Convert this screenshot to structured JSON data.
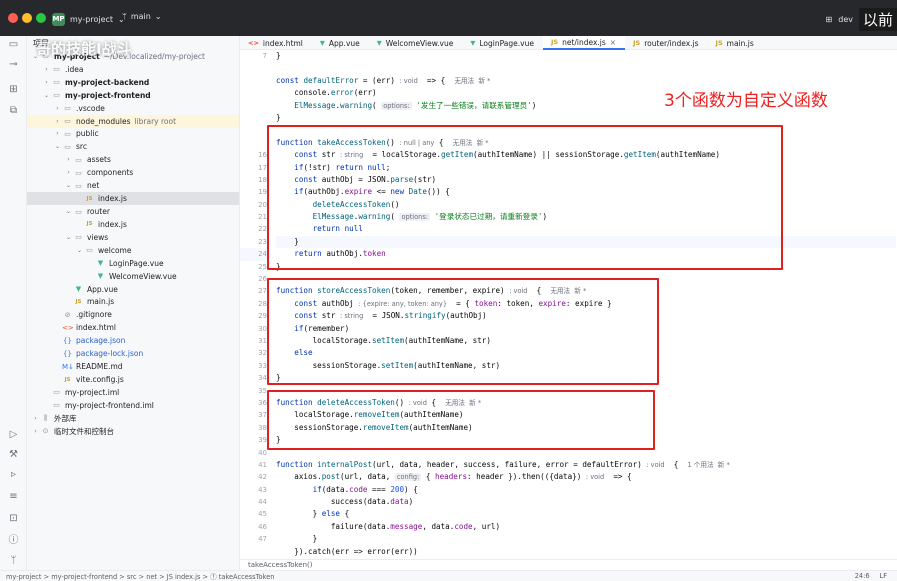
{
  "window": {
    "project_badge": "MP",
    "project_name": "my-project",
    "branch": "main",
    "right_text": "dev",
    "overlay_text": "以前"
  },
  "tabs": [
    {
      "label": "index.html",
      "icon": "<>",
      "color": "#e44d26",
      "active": false
    },
    {
      "label": "App.vue",
      "icon": "▼",
      "color": "#3fb883",
      "active": false
    },
    {
      "label": "WelcomeView.vue",
      "icon": "▼",
      "color": "#3fb883",
      "active": false
    },
    {
      "label": "LoginPage.vue",
      "icon": "▼",
      "color": "#3fb883",
      "active": false
    },
    {
      "label": "net/index.js",
      "icon": "JS",
      "color": "#c9a227",
      "active": true
    },
    {
      "label": "router/index.js",
      "icon": "JS",
      "color": "#c9a227",
      "active": false
    },
    {
      "label": "main.js",
      "icon": "JS",
      "color": "#c9a227",
      "active": false
    }
  ],
  "project_panel": {
    "title": "项目",
    "watermark": "哥的技能Ⅰ战斗"
  },
  "tree": [
    {
      "d": 0,
      "a": "v",
      "ic": "📁",
      "t": "my-project",
      "b": true,
      "m": "~/Dev.localized/my-project"
    },
    {
      "d": 1,
      "a": ">",
      "ic": "📁",
      "t": ".idea"
    },
    {
      "d": 1,
      "a": ">",
      "ic": "📁",
      "t": "my-project-backend",
      "b": true
    },
    {
      "d": 1,
      "a": "v",
      "ic": "📁",
      "t": "my-project-frontend",
      "b": true
    },
    {
      "d": 2,
      "a": ">",
      "ic": "📁",
      "t": ".vscode"
    },
    {
      "d": 2,
      "a": ">",
      "ic": "📁",
      "t": "node_modules",
      "m": "library root",
      "h": true
    },
    {
      "d": 2,
      "a": ">",
      "ic": "📁",
      "t": "public"
    },
    {
      "d": 2,
      "a": "v",
      "ic": "📁",
      "t": "src"
    },
    {
      "d": 3,
      "a": ">",
      "ic": "📁",
      "t": "assets"
    },
    {
      "d": 3,
      "a": ">",
      "ic": "📁",
      "t": "components"
    },
    {
      "d": 3,
      "a": "v",
      "ic": "📁",
      "t": "net"
    },
    {
      "d": 4,
      "a": "",
      "ic": "JS",
      "t": "index.js",
      "s": true
    },
    {
      "d": 3,
      "a": "v",
      "ic": "📁",
      "t": "router"
    },
    {
      "d": 4,
      "a": "",
      "ic": "JS",
      "t": "index.js"
    },
    {
      "d": 3,
      "a": "v",
      "ic": "📁",
      "t": "views"
    },
    {
      "d": 4,
      "a": "v",
      "ic": "📁",
      "t": "welcome"
    },
    {
      "d": 5,
      "a": "",
      "ic": "▼",
      "t": "LoginPage.vue"
    },
    {
      "d": 5,
      "a": "",
      "ic": "▼",
      "t": "WelcomeView.vue"
    },
    {
      "d": 3,
      "a": "",
      "ic": "▼",
      "t": "App.vue"
    },
    {
      "d": 3,
      "a": "",
      "ic": "JS",
      "t": "main.js"
    },
    {
      "d": 2,
      "a": "",
      "ic": "⊘",
      "t": ".gitignore"
    },
    {
      "d": 2,
      "a": "",
      "ic": "<>",
      "t": "index.html"
    },
    {
      "d": 2,
      "a": "",
      "ic": "{}",
      "t": "package.json",
      "blue": true
    },
    {
      "d": 2,
      "a": "",
      "ic": "{}",
      "t": "package-lock.json",
      "blue": true
    },
    {
      "d": 2,
      "a": "",
      "ic": "M↓",
      "t": "README.md"
    },
    {
      "d": 2,
      "a": "",
      "ic": "JS",
      "t": "vite.config.js"
    },
    {
      "d": 1,
      "a": "",
      "ic": "▭",
      "t": "my-project.iml"
    },
    {
      "d": 1,
      "a": "",
      "ic": "▭",
      "t": "my-project-frontend.iml"
    },
    {
      "d": 0,
      "a": ">",
      "ic": "⫼",
      "t": "外部库"
    },
    {
      "d": 0,
      "a": ">",
      "ic": "⊙",
      "t": "临时文件和控制台"
    }
  ],
  "gutter": [
    "7",
    "",
    "",
    "",
    "",
    "",
    "",
    "",
    "16",
    "17",
    "18",
    "19",
    "20",
    "21",
    "22",
    "23",
    "24",
    "25",
    "26",
    "27",
    "28",
    "29",
    "30",
    "31",
    "32",
    "33",
    "34",
    "35",
    "36",
    "37",
    "38",
    "39",
    "40",
    "41",
    "42",
    "43",
    "44",
    "45",
    "46",
    "47",
    ""
  ],
  "code": [
    [
      [
        "p",
        "}"
      ]
    ],
    [
      [
        "p",
        ""
      ]
    ],
    [
      [
        "kw",
        "const "
      ],
      [
        "fn",
        "defaultError"
      ],
      [
        "p",
        " = ("
      ],
      [
        "p",
        "err"
      ],
      [
        "p",
        ") "
      ],
      [
        "hint",
        ": void"
      ],
      [
        "p",
        "  => {  "
      ],
      [
        "hint",
        "无用法  新 *"
      ]
    ],
    [
      [
        "p",
        "    console."
      ],
      [
        "fn",
        "error"
      ],
      [
        "p",
        "(err)"
      ]
    ],
    [
      [
        "p",
        "    "
      ],
      [
        "fn",
        "ElMessage"
      ],
      [
        "p",
        "."
      ],
      [
        "fn",
        "warning"
      ],
      [
        "p",
        "( "
      ],
      [
        "hintbox",
        "options:"
      ],
      [
        "str",
        " '发生了一些错误，请联系管理员'"
      ],
      [
        "p",
        ")"
      ]
    ],
    [
      [
        "p",
        "}"
      ]
    ],
    [
      [
        "p",
        ""
      ]
    ],
    [
      [
        "kw",
        "function "
      ],
      [
        "fn",
        "takeAccessToken"
      ],
      [
        "p",
        "() "
      ],
      [
        "hint",
        ": null | any"
      ],
      [
        "p",
        " {  "
      ],
      [
        "hint",
        "无用法  新 *"
      ]
    ],
    [
      [
        "p",
        "    "
      ],
      [
        "kw",
        "const "
      ],
      [
        "p",
        "str "
      ],
      [
        "hint",
        ": string"
      ],
      [
        "p",
        "  = localStorage."
      ],
      [
        "fn",
        "getItem"
      ],
      [
        "p",
        "(authItemName) || sessionStorage."
      ],
      [
        "fn",
        "getItem"
      ],
      [
        "p",
        "(authItemName)"
      ]
    ],
    [
      [
        "p",
        "    "
      ],
      [
        "kw",
        "if"
      ],
      [
        "p",
        "(!str) "
      ],
      [
        "kw",
        "return null"
      ],
      [
        "p",
        ";"
      ]
    ],
    [
      [
        "p",
        "    "
      ],
      [
        "kw",
        "const "
      ],
      [
        "p",
        "authObj = JSON."
      ],
      [
        "fn",
        "parse"
      ],
      [
        "p",
        "(str)"
      ]
    ],
    [
      [
        "p",
        "    "
      ],
      [
        "kw",
        "if"
      ],
      [
        "p",
        "(authObj."
      ],
      [
        "prop",
        "expire"
      ],
      [
        "p",
        " <= "
      ],
      [
        "kw",
        "new "
      ],
      [
        "fn",
        "Date"
      ],
      [
        "p",
        "()) {"
      ]
    ],
    [
      [
        "p",
        "        "
      ],
      [
        "fn",
        "deleteAccessToken"
      ],
      [
        "p",
        "()"
      ]
    ],
    [
      [
        "p",
        "        "
      ],
      [
        "fn",
        "ElMessage"
      ],
      [
        "p",
        "."
      ],
      [
        "fn",
        "warning"
      ],
      [
        "p",
        "( "
      ],
      [
        "hintbox",
        "options:"
      ],
      [
        "str",
        " '登录状态已过期，请重新登录'"
      ],
      [
        "p",
        ")"
      ]
    ],
    [
      [
        "p",
        "        "
      ],
      [
        "kw",
        "return null"
      ]
    ],
    [
      [
        "p",
        "    }"
      ]
    ],
    [
      [
        "p",
        "    "
      ],
      [
        "kw",
        "return "
      ],
      [
        "p",
        "authObj."
      ],
      [
        "prop",
        "token"
      ]
    ],
    [
      [
        "p",
        "}"
      ]
    ],
    [
      [
        "p",
        ""
      ]
    ],
    [
      [
        "kw",
        "function "
      ],
      [
        "fn",
        "storeAccessToken"
      ],
      [
        "p",
        "(token, remember, expire) "
      ],
      [
        "hint",
        ": void"
      ],
      [
        "p",
        "  {  "
      ],
      [
        "hint",
        "无用法  新 *"
      ]
    ],
    [
      [
        "p",
        "    "
      ],
      [
        "kw",
        "const "
      ],
      [
        "p",
        "authObj "
      ],
      [
        "hint",
        ": {expire: any, token: any}"
      ],
      [
        "p",
        "  = { "
      ],
      [
        "prop",
        "token"
      ],
      [
        "p",
        ": token, "
      ],
      [
        "prop",
        "expire"
      ],
      [
        "p",
        ": expire }"
      ]
    ],
    [
      [
        "p",
        "    "
      ],
      [
        "kw",
        "const "
      ],
      [
        "p",
        "str "
      ],
      [
        "hint",
        ": string"
      ],
      [
        "p",
        "  = JSON."
      ],
      [
        "fn",
        "stringify"
      ],
      [
        "p",
        "(authObj)"
      ]
    ],
    [
      [
        "p",
        "    "
      ],
      [
        "kw",
        "if"
      ],
      [
        "p",
        "(remember)"
      ]
    ],
    [
      [
        "p",
        "        localStorage."
      ],
      [
        "fn",
        "setItem"
      ],
      [
        "p",
        "(authItemName, str)"
      ]
    ],
    [
      [
        "kw",
        "    else"
      ]
    ],
    [
      [
        "p",
        "        sessionStorage."
      ],
      [
        "fn",
        "setItem"
      ],
      [
        "p",
        "(authItemName, str)"
      ]
    ],
    [
      [
        "p",
        "}"
      ]
    ],
    [
      [
        "p",
        ""
      ]
    ],
    [
      [
        "kw",
        "function "
      ],
      [
        "fn",
        "deleteAccessToken"
      ],
      [
        "p",
        "() "
      ],
      [
        "hint",
        ": void"
      ],
      [
        "p",
        " {  "
      ],
      [
        "hint",
        "无用法  新 *"
      ]
    ],
    [
      [
        "p",
        "    localStorage."
      ],
      [
        "fn",
        "removeItem"
      ],
      [
        "p",
        "(authItemName)"
      ]
    ],
    [
      [
        "p",
        "    sessionStorage."
      ],
      [
        "fn",
        "removeItem"
      ],
      [
        "p",
        "(authItemName)"
      ]
    ],
    [
      [
        "p",
        "}"
      ]
    ],
    [
      [
        "p",
        ""
      ]
    ],
    [
      [
        "kw",
        "function "
      ],
      [
        "fn",
        "internalPost"
      ],
      [
        "p",
        "(url, data, header, success, failure, error = defaultError) "
      ],
      [
        "hint",
        ": void"
      ],
      [
        "p",
        "  {  "
      ],
      [
        "hint",
        "1 个用法  新 *"
      ]
    ],
    [
      [
        "p",
        "    axios."
      ],
      [
        "fn",
        "post"
      ],
      [
        "p",
        "(url, data, "
      ],
      [
        "hintbox",
        "config:"
      ],
      [
        "p",
        " { "
      ],
      [
        "prop",
        "headers"
      ],
      [
        "p",
        ": header }).then(({data}) "
      ],
      [
        "hint",
        ": void"
      ],
      [
        "p",
        "  => {"
      ]
    ],
    [
      [
        "p",
        "        "
      ],
      [
        "kw",
        "if"
      ],
      [
        "p",
        "(data."
      ],
      [
        "prop",
        "code"
      ],
      [
        "p",
        " === "
      ],
      [
        "num",
        "200"
      ],
      [
        "p",
        ") {"
      ]
    ],
    [
      [
        "p",
        "            success(data."
      ],
      [
        "prop",
        "data"
      ],
      [
        "p",
        ")"
      ]
    ],
    [
      [
        "p",
        "        } "
      ],
      [
        "kw",
        "else "
      ],
      [
        "p",
        "{"
      ]
    ],
    [
      [
        "p",
        "            failure(data."
      ],
      [
        "prop",
        "message"
      ],
      [
        "p",
        ", data."
      ],
      [
        "prop",
        "code"
      ],
      [
        "p",
        ", url)"
      ]
    ],
    [
      [
        "p",
        "        }"
      ]
    ],
    [
      [
        "p",
        "    }).catch(err => error(err))"
      ]
    ]
  ],
  "annotation": "3个函数为自定义函数",
  "breadcrumb": "takeAccessToken()",
  "status": {
    "path": "my-project  >  my-project-frontend  >  src  >  net  >  JS index.js  >  ⓕ takeAccessToken",
    "position": "24:6",
    "indent": "LF"
  }
}
